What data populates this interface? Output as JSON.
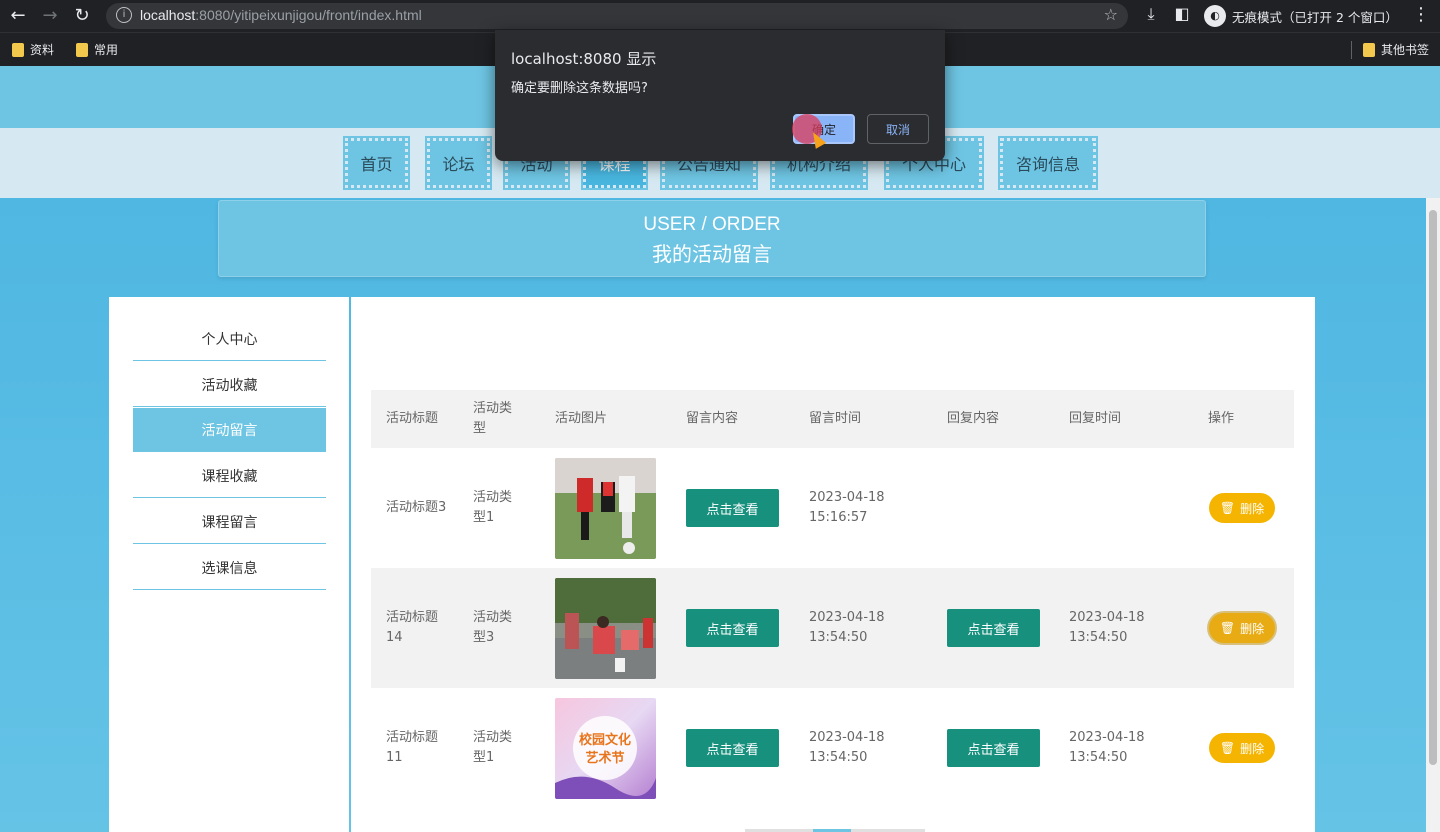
{
  "browser": {
    "url_host": "localhost",
    "url_rest": ":8080/yitipeixunjigou/front/index.html",
    "incognito_label": "无痕模式（已打开 2 个窗口）",
    "bookmarks": [
      "资料",
      "常用"
    ],
    "other_bookmarks": "其他书签"
  },
  "dialog": {
    "title": "localhost:8080 显示",
    "message": "确定要删除这条数据吗?",
    "ok_label": "确定",
    "cancel_label": "取消"
  },
  "nav": [
    "首页",
    "论坛",
    "活动",
    "课程",
    "公告通知",
    "机构介绍",
    "个人中心",
    "咨询信息"
  ],
  "banner": {
    "en": "USER / ORDER",
    "cn": "我的活动留言"
  },
  "sidebar": [
    "个人中心",
    "活动收藏",
    "活动留言",
    "课程收藏",
    "课程留言",
    "选课信息"
  ],
  "table": {
    "headers": [
      "活动标题",
      "活动类型",
      "活动图片",
      "留言内容",
      "留言时间",
      "回复内容",
      "回复时间",
      "操作"
    ],
    "rows": [
      {
        "title": "活动标题3",
        "type": "活动类型1",
        "image": "soccer-kids-photo",
        "view_label": "点击查看",
        "time": "2023-04-18 15:16:57",
        "reply_label": "",
        "reply_time": "",
        "delete_label": "删除"
      },
      {
        "title": "活动标题14",
        "type": "活动类型3",
        "image": "outdoor-kids-photo",
        "view_label": "点击查看",
        "time": "2023-04-18 13:54:50",
        "reply_label": "点击查看",
        "reply_time": "2023-04-18 13:54:50",
        "delete_label": "删除"
      },
      {
        "title": "活动标题11",
        "type": "活动类型1",
        "image": "art-festival-poster",
        "view_label": "点击查看",
        "time": "2023-04-18 13:54:50",
        "reply_label": "点击查看",
        "reply_time": "2023-04-18 13:54:50",
        "delete_label": "删除"
      }
    ]
  },
  "poster_text": "校园文化艺术节"
}
